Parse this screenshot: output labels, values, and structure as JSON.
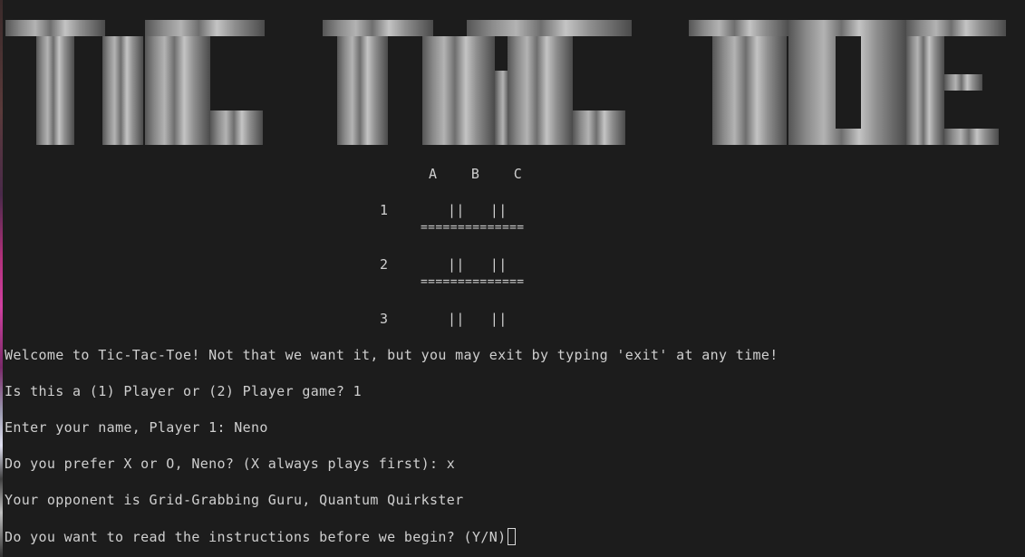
{
  "title": "TIC TAC TOE",
  "board": {
    "column_header": "A    B    C",
    "rows": [
      {
        "label": "1",
        "cells": "||   ||",
        "separator": "=============="
      },
      {
        "label": "2",
        "cells": "||   ||",
        "separator": "=============="
      },
      {
        "label": "3",
        "cells": "||   ||"
      }
    ]
  },
  "console": {
    "welcome": "Welcome to Tic-Tac-Toe! Not that we want it, but you may exit by typing 'exit' at any time!",
    "players_prompt": "Is this a (1) Player or (2) Player game? 1",
    "name_prompt": "Enter your name, Player 1: Neno",
    "symbol_prompt": "Do you prefer X or O, Neno? (X always plays first): x",
    "opponent": "Your opponent is Grid-Grabbing Guru, Quantum Quirkster",
    "instructions_prompt": "Do you want to read the instructions before we begin? (Y/N)"
  },
  "colors": {
    "background": "#1c1c1c",
    "text": "#cfcfcf"
  }
}
